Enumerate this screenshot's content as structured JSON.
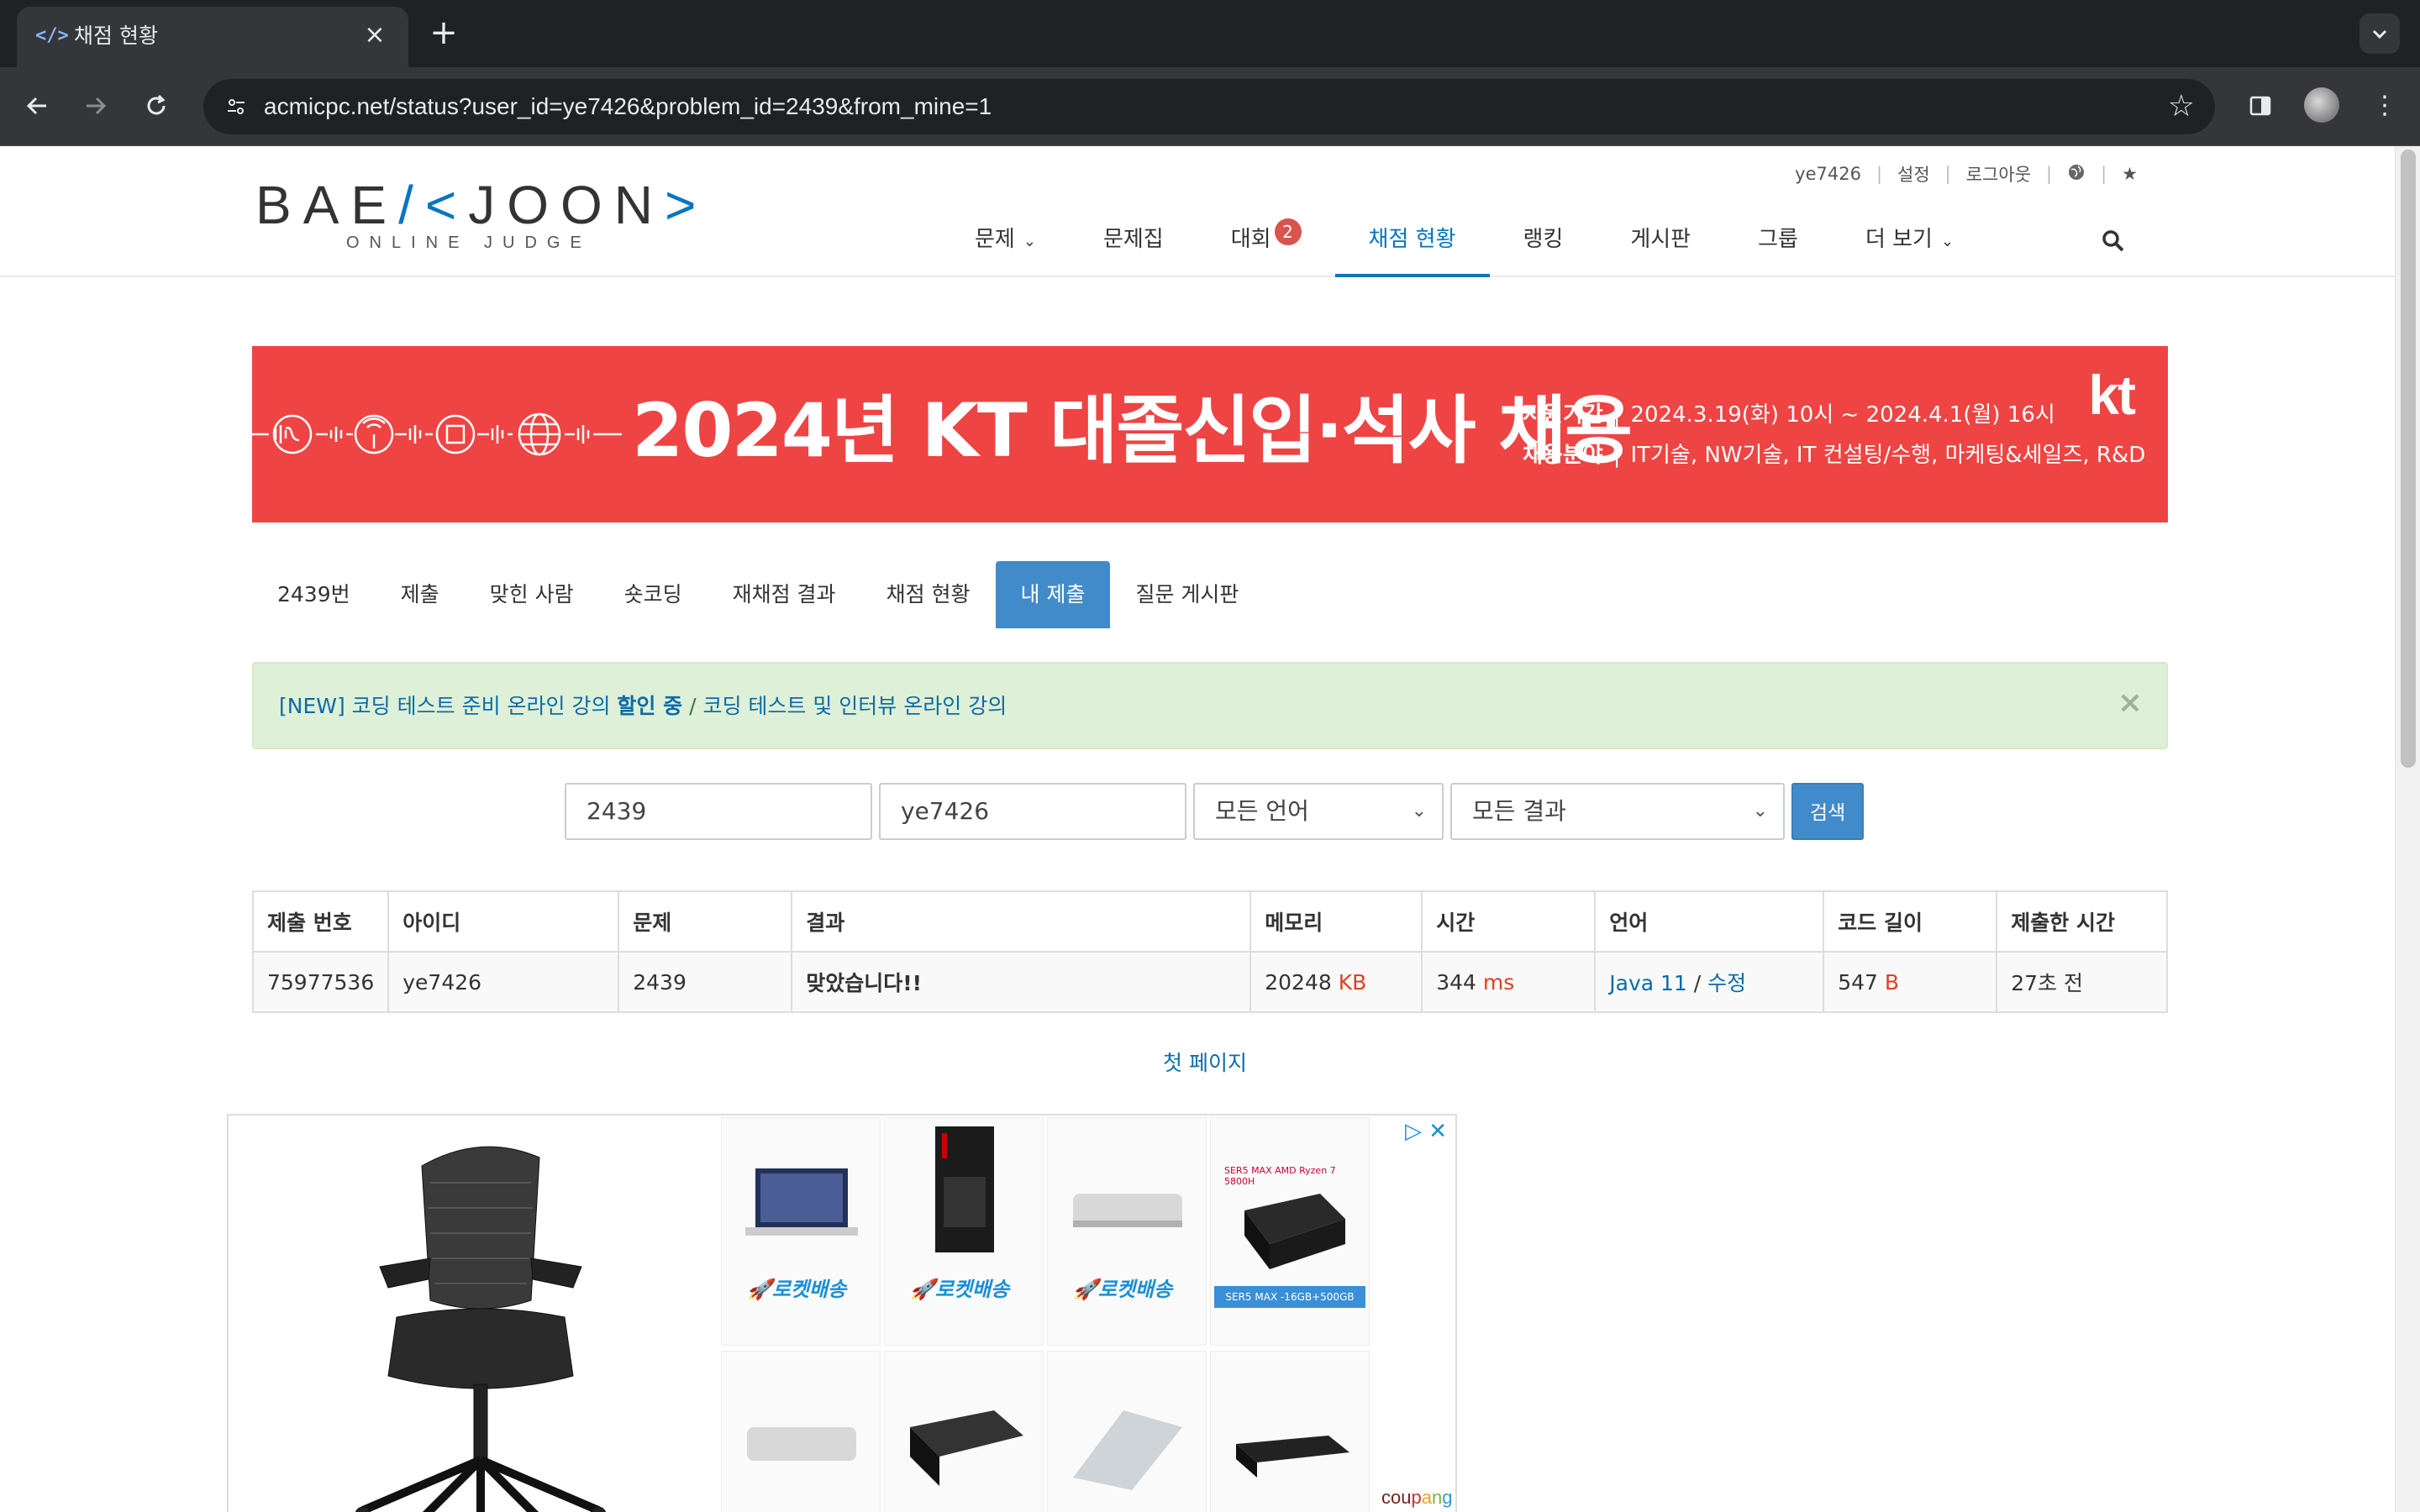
{
  "browser": {
    "tab_title": "채점 현황",
    "tab_favicon": "</>",
    "url": "acmicpc.net/status?user_id=ye7426&problem_id=2439&from_mine=1"
  },
  "header": {
    "logo_pre": "BAE",
    "logo_k": "/<",
    "logo_post": "JOON",
    "logo_end": ">",
    "logo_sub": "ONLINE JUDGE",
    "top_links": {
      "user": "ye7426",
      "settings": "설정",
      "logout": "로그아웃"
    },
    "nav": {
      "problems": "문제",
      "workbook": "문제집",
      "contest": "대회",
      "contest_badge": "2",
      "status": "채점 현황",
      "ranking": "랭킹",
      "board": "게시판",
      "group": "그룹",
      "more": "더 보기"
    }
  },
  "banner": {
    "title": "2024년 KT 대졸신입·석사 채용",
    "period_label": "지원기간",
    "period_value": "2024.3.19(화) 10시 ~ 2024.4.1(월) 16시",
    "field_label": "채용분야",
    "field_value": "IT기술, NW기술, IT 컨설팅/수행, 마케팅&세일즈, R&D",
    "brand": "kt",
    "background_color": "#ee4443"
  },
  "problem_tabs": {
    "number": "2439번",
    "submit": "제출",
    "solvers": "맞힌 사람",
    "shortcoding": "숏코딩",
    "rejudge": "재채점 결과",
    "status": "채점 현황",
    "my_submissions": "내 제출",
    "qna": "질문 게시판"
  },
  "alert": {
    "part1": "[NEW] 코딩 테스트 준비 온라인 강의 ",
    "part1_bold": "할인 중",
    "slash": " / ",
    "part2": "코딩 테스트 및 인터뷰 온라인 강의",
    "close": "×"
  },
  "filters": {
    "problem_id": "2439",
    "user_id": "ye7426",
    "language": "모든 언어",
    "result": "모든 결과",
    "search_button": "검색"
  },
  "table": {
    "headers": {
      "id": "제출 번호",
      "user": "아이디",
      "problem": "문제",
      "result": "결과",
      "memory": "메모리",
      "time": "시간",
      "language": "언어",
      "code_length": "코드 길이",
      "submitted_at": "제출한 시간"
    },
    "row": {
      "id": "75977536",
      "user": "ye7426",
      "problem": "2439",
      "result": "맞았습니다!!",
      "memory": "20248",
      "memory_unit": "KB",
      "time": "344",
      "time_unit": "ms",
      "language": "Java 11",
      "lang_sep": " / ",
      "edit": "수정",
      "code_length": "547",
      "code_unit": "B",
      "submitted_at": "27초 전"
    }
  },
  "pagination": {
    "first_page": "첫 페이지"
  },
  "ad": {
    "rocket_label": "🚀로켓배송",
    "ser5_top": "SER5 MAX AMD Ryzen 7 5800H",
    "ser5_bottom": "SER5 MAX -16GB+500GB",
    "coupang_1": "cou",
    "coupang_2": "p",
    "coupang_3": "a",
    "coupang_4": "n",
    "coupang_5": "g"
  },
  "colors": {
    "accent": "#0076c0",
    "link": "#0b6ba8",
    "active_tab": "#428bca",
    "accepted": "#009874",
    "unit": "#dd4124"
  }
}
